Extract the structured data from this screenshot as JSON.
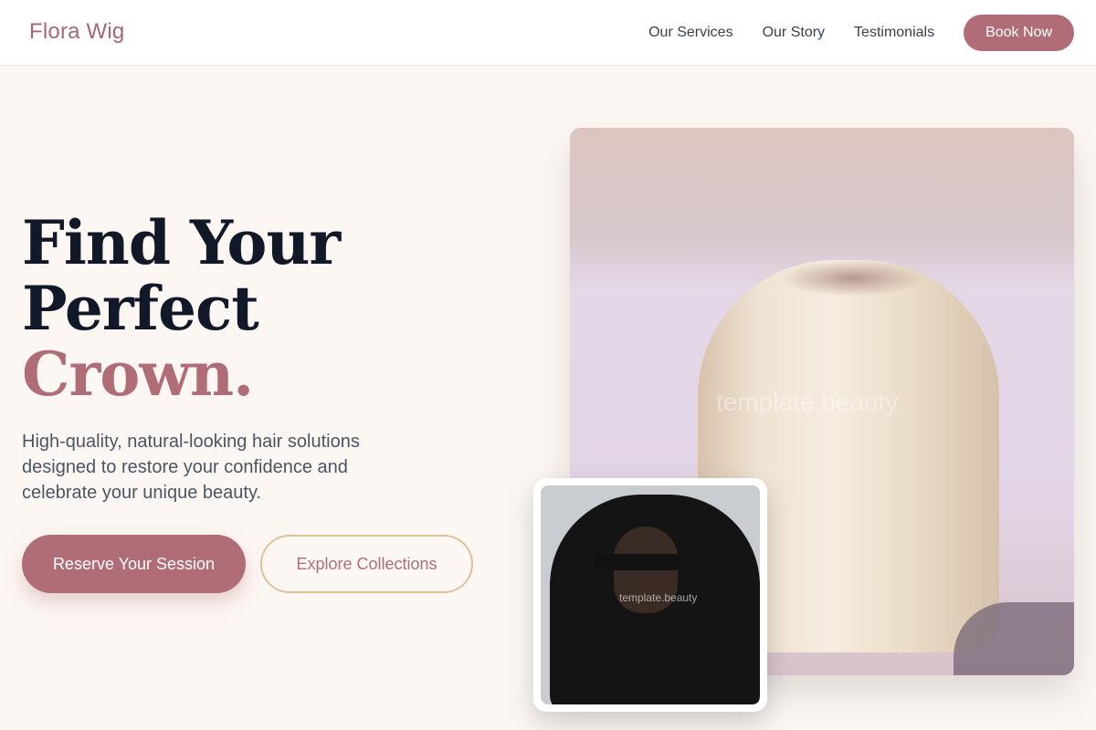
{
  "header": {
    "logo": "Flora Wig",
    "nav": [
      "Our Services",
      "Our Story",
      "Testimonials"
    ],
    "book_label": "Book Now"
  },
  "hero": {
    "title_line1": "Find Your",
    "title_line2": "Perfect",
    "title_line3": "Crown.",
    "subtitle": "High-quality, natural-looking hair solutions designed to restore your confidence and celebrate your unique beauty.",
    "primary_cta": "Reserve Your Session",
    "secondary_cta": "Explore Collections"
  },
  "images": {
    "main_watermark": "template.beauty",
    "inset_watermark": "template.beauty"
  },
  "colors": {
    "accent": "#b06d78",
    "gold_border": "#dcc39a",
    "background": "#fdf7f3",
    "heading": "#111827"
  }
}
